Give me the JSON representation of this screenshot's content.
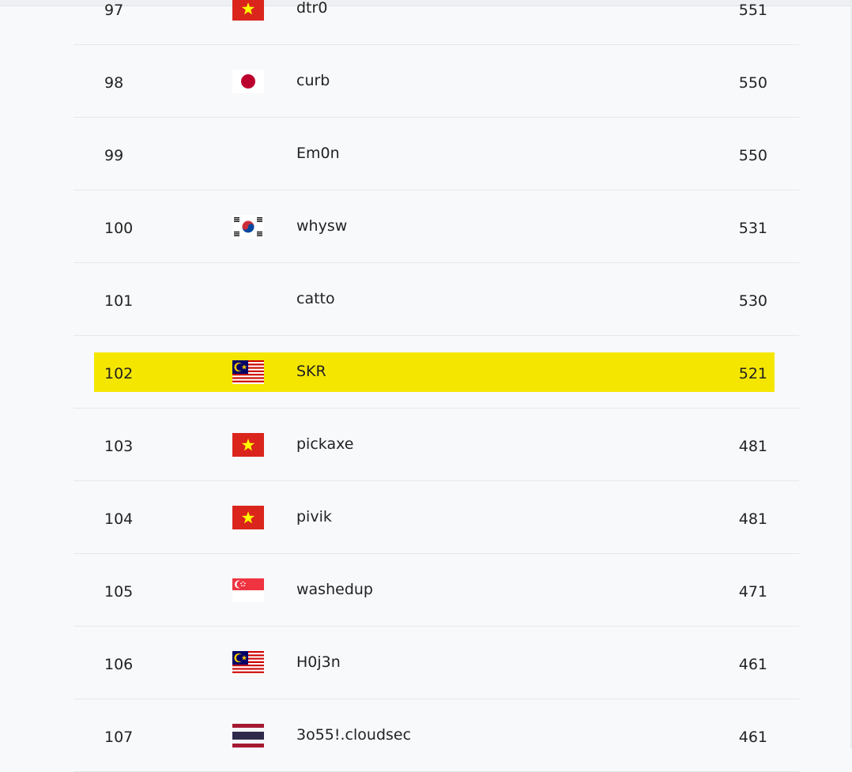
{
  "rows": [
    {
      "rank": "97",
      "flag": "vietnam-flag",
      "name": "dtr0",
      "score": "551",
      "highlighted": false
    },
    {
      "rank": "98",
      "flag": "japan-flag",
      "name": "curb",
      "score": "550",
      "highlighted": false
    },
    {
      "rank": "99",
      "flag": "",
      "name": "Em0n",
      "score": "550",
      "highlighted": false
    },
    {
      "rank": "100",
      "flag": "south-korea-flag",
      "name": "whysw",
      "score": "531",
      "highlighted": false
    },
    {
      "rank": "101",
      "flag": "",
      "name": "catto",
      "score": "530",
      "highlighted": false
    },
    {
      "rank": "102",
      "flag": "malaysia-flag",
      "name": "SKR",
      "score": "521",
      "highlighted": true
    },
    {
      "rank": "103",
      "flag": "vietnam-flag",
      "name": "pickaxe",
      "score": "481",
      "highlighted": false
    },
    {
      "rank": "104",
      "flag": "vietnam-flag",
      "name": "pivik",
      "score": "481",
      "highlighted": false
    },
    {
      "rank": "105",
      "flag": "singapore-flag",
      "name": "washedup",
      "score": "471",
      "highlighted": false
    },
    {
      "rank": "106",
      "flag": "malaysia-flag",
      "name": "H0j3n",
      "score": "461",
      "highlighted": false
    },
    {
      "rank": "107",
      "flag": "thailand-flag",
      "name": "3o55!.cloudsec",
      "score": "461",
      "highlighted": false
    }
  ],
  "colors": {
    "highlight": "#f5e600",
    "background": "#f7f9fb",
    "divider": "#e6e9ec"
  }
}
